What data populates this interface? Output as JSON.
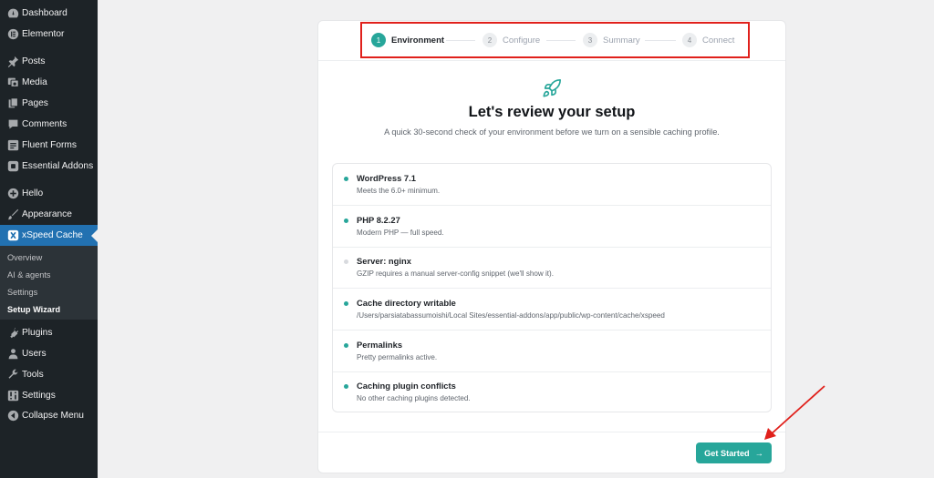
{
  "sidebar": {
    "items": [
      {
        "label": "Dashboard",
        "icon": "dashboard-icon"
      },
      {
        "label": "Elementor",
        "icon": "elementor-icon"
      },
      {
        "label": "Posts",
        "icon": "pin-icon"
      },
      {
        "label": "Media",
        "icon": "media-icon"
      },
      {
        "label": "Pages",
        "icon": "pages-icon"
      },
      {
        "label": "Comments",
        "icon": "comments-icon"
      },
      {
        "label": "Fluent Forms",
        "icon": "forms-icon"
      },
      {
        "label": "Essential Addons",
        "icon": "addons-icon"
      },
      {
        "label": "Hello",
        "icon": "plus-circle-icon"
      },
      {
        "label": "Appearance",
        "icon": "brush-icon"
      },
      {
        "label": "xSpeed Cache",
        "icon": "xspeed-icon"
      },
      {
        "label": "Plugins",
        "icon": "plug-icon"
      },
      {
        "label": "Users",
        "icon": "users-icon"
      },
      {
        "label": "Tools",
        "icon": "wrench-icon"
      },
      {
        "label": "Settings",
        "icon": "settings-icon"
      },
      {
        "label": "Collapse Menu",
        "icon": "collapse-icon"
      }
    ],
    "submenu": [
      "Overview",
      "AI & agents",
      "Settings",
      "Setup Wizard"
    ]
  },
  "stepper": {
    "steps": [
      {
        "num": "1",
        "label": "Environment"
      },
      {
        "num": "2",
        "label": "Configure"
      },
      {
        "num": "3",
        "label": "Summary"
      },
      {
        "num": "4",
        "label": "Connect"
      }
    ]
  },
  "main": {
    "title": "Let's review your setup",
    "subtitle": "A quick 30-second check of your environment before we turn on a sensible caching profile.",
    "checks": [
      {
        "title": "WordPress 7.1",
        "desc": "Meets the 6.0+ minimum.",
        "status": "ok"
      },
      {
        "title": "PHP 8.2.27",
        "desc": "Modern PHP — full speed.",
        "status": "ok"
      },
      {
        "title": "Server: nginx",
        "desc": "GZIP requires a manual server-config snippet (we'll show it).",
        "status": "info"
      },
      {
        "title": "Cache directory writable",
        "desc": "/Users/parsiatabassumoishi/Local Sites/essential-addons/app/public/wp-content/cache/xspeed",
        "status": "ok"
      },
      {
        "title": "Permalinks",
        "desc": "Pretty permalinks active.",
        "status": "ok"
      },
      {
        "title": "Caching plugin conflicts",
        "desc": "No other caching plugins detected.",
        "status": "ok"
      }
    ],
    "button_label": "Get Started",
    "button_arrow": "→"
  },
  "colors": {
    "sidebar_bg": "#1d2327",
    "sidebar_active": "#2271b1",
    "accent": "#27a69a",
    "annotation": "#e0201b"
  }
}
